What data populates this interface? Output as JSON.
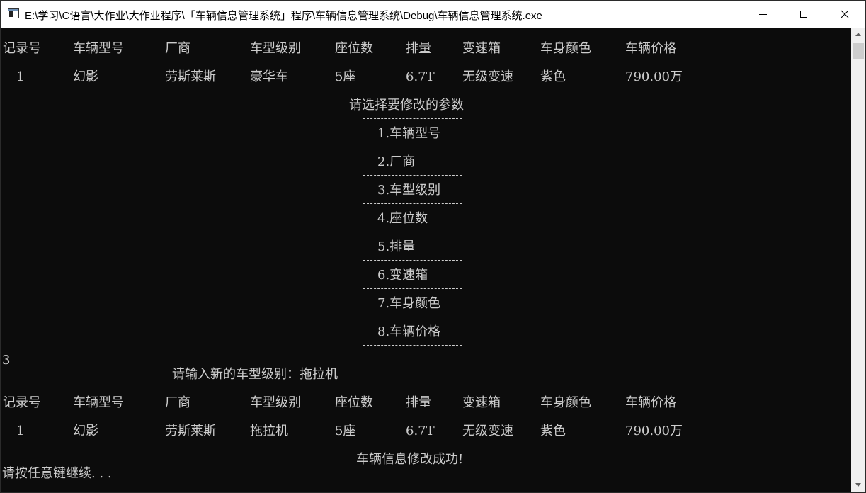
{
  "window": {
    "title": "E:\\学习\\C语言\\大作业\\大作业程序\\「车辆信息管理系统」程序\\车辆信息管理系统\\Debug\\车辆信息管理系统.exe",
    "icon": "console-window-icon"
  },
  "console": {
    "table_headers": [
      "记录号",
      "车辆型号",
      "厂商",
      "车型级别",
      "座位数",
      "排量",
      "变速箱",
      "车身颜色",
      "车辆价格"
    ],
    "record_before": [
      "1",
      "幻影",
      "劳斯莱斯",
      "豪华车",
      "5座",
      "6.7T",
      "无级变速",
      "紫色",
      "790.00万"
    ],
    "menu_prompt": "请选择要修改的参数",
    "menu_items": [
      {
        "label": "1.车辆型号"
      },
      {
        "label": "2.厂商"
      },
      {
        "label": "3.车型级别"
      },
      {
        "label": "4.座位数"
      },
      {
        "label": "5.排量"
      },
      {
        "label": "6.变速箱"
      },
      {
        "label": "7.车身颜色"
      },
      {
        "label": "8.车辆价格"
      }
    ],
    "user_choice": "3",
    "input_prompt": "请输入新的车型级别：",
    "input_value": "拖拉机",
    "record_after": [
      "1",
      "幻影",
      "劳斯莱斯",
      "拖拉机",
      "5座",
      "6.7T",
      "无级变速",
      "紫色",
      "790.00万"
    ],
    "success_message": "车辆信息修改成功!",
    "continue_prompt": "请按任意键继续. . ."
  },
  "colors": {
    "console_background": "#0c0c0c",
    "console_text": "#cccccc",
    "titlebar_background": "#ffffff"
  }
}
